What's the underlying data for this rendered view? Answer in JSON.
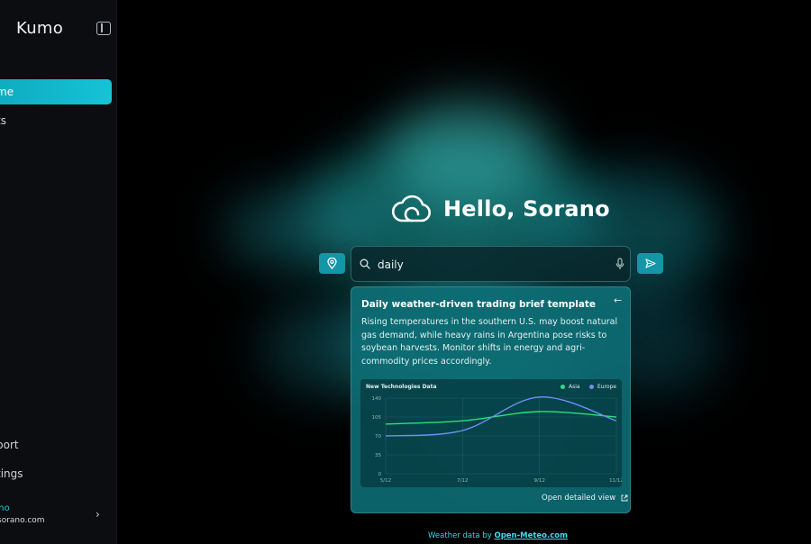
{
  "sidebar": {
    "brand": "Kumo",
    "items": [
      {
        "label": "me",
        "active": true
      },
      {
        "label": "ts",
        "active": false
      }
    ],
    "bottom_items": [
      {
        "label": "port"
      },
      {
        "label": "tings"
      }
    ],
    "user": {
      "name": "rano",
      "email": "@sorano.com"
    }
  },
  "hero": {
    "title": "Hello, Sorano",
    "icon": "cloud-icon"
  },
  "search": {
    "value": "daily"
  },
  "suggestion": {
    "title": "Daily weather-driven trading brief template",
    "body": "Rising temperatures in the southern U.S. may boost natural gas demand, while heavy rains in Argentina pose risks to soybean harvests. Monitor shifts in energy and agri-commodity prices accordingly.",
    "footer": "Open detailed view"
  },
  "chart_data": {
    "type": "line",
    "title": "New Technologies Data",
    "x": [
      "5/12",
      "7/12",
      "9/12",
      "11/12"
    ],
    "ylim": [
      0,
      140
    ],
    "yticks": [
      0,
      35,
      70,
      105,
      140
    ],
    "grid": true,
    "legend": "top-right",
    "series": [
      {
        "name": "Asia",
        "color": "#2be07a",
        "values": [
          92,
          98,
          115,
          105
        ]
      },
      {
        "name": "Europe",
        "color": "#6f8ff0",
        "values": [
          70,
          80,
          142,
          98
        ]
      }
    ]
  },
  "credit": {
    "prefix": "Weather data by",
    "link": "Open-Meteo.com"
  },
  "colors": {
    "accent": "#16c3d6",
    "card": "#0e7078"
  }
}
